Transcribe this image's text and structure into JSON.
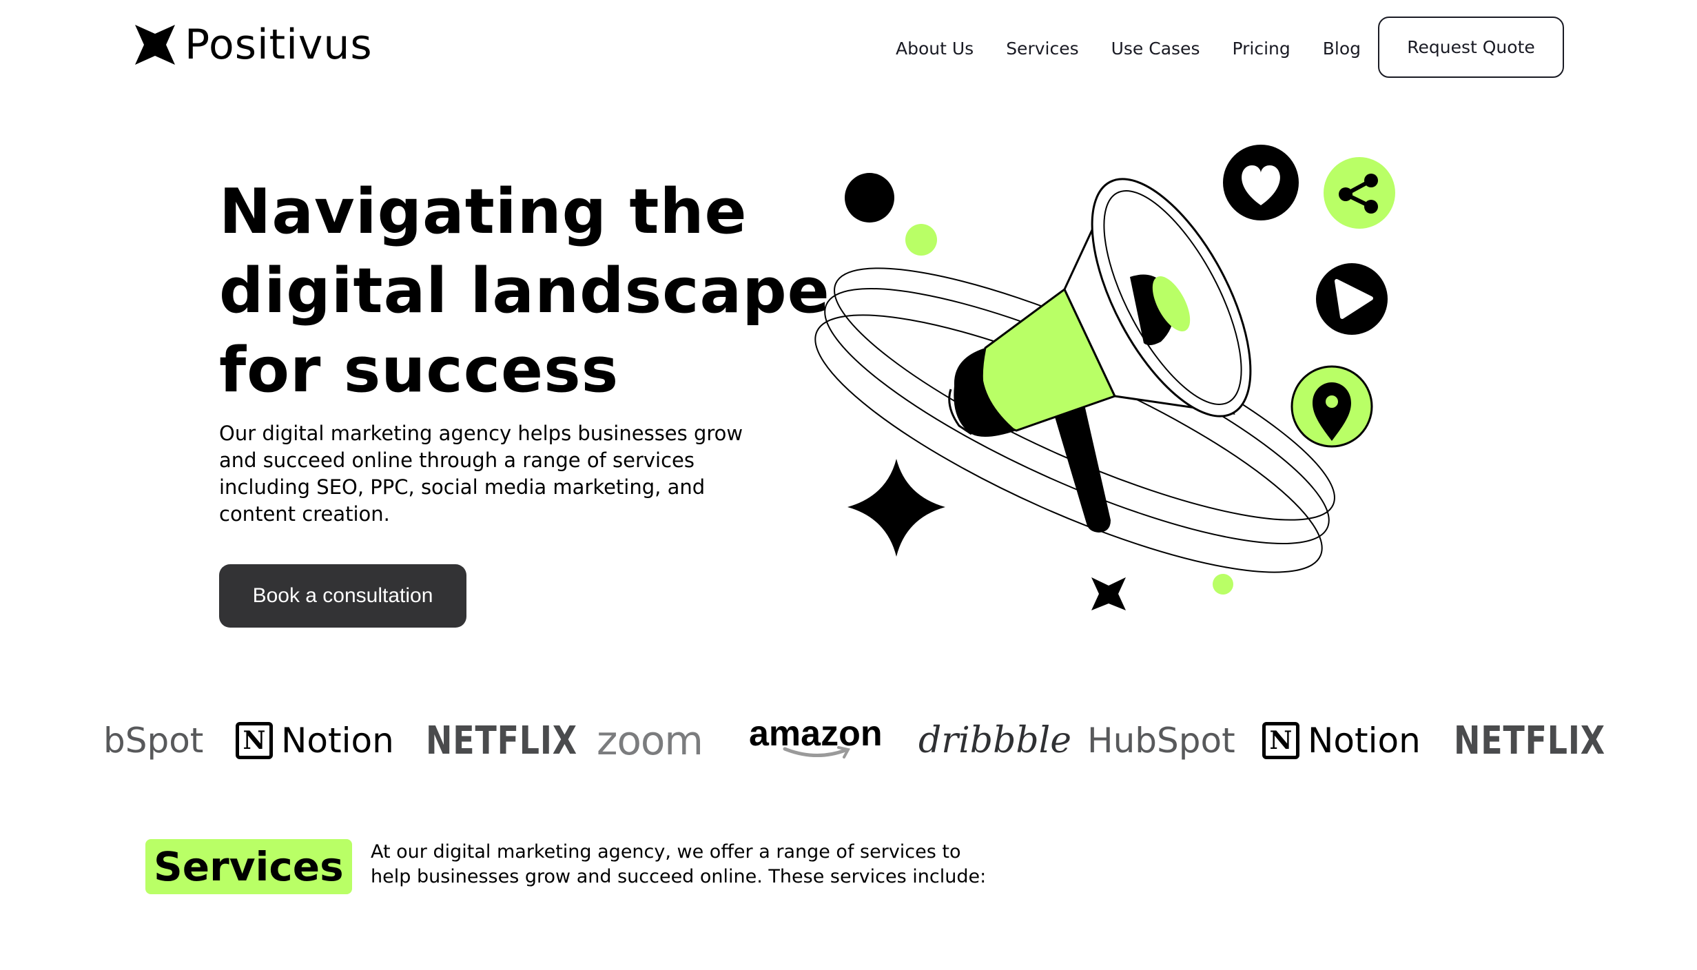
{
  "header": {
    "brand": "Positivus",
    "nav": [
      "About Us",
      "Services",
      "Use Cases",
      "Pricing",
      "Blog"
    ],
    "cta_label": "Request Quote"
  },
  "hero": {
    "title_lines": [
      "Navigating the",
      "digital landscape",
      "for success"
    ],
    "description": "Our digital marketing agency helps businesses grow and succeed online through a range of services including SEO, PPC, social media marketing, and content creation.",
    "cta_label": "Book a consultation",
    "illustration_icons": [
      "megaphone-icon",
      "heart-icon",
      "share-icon",
      "play-icon",
      "location-pin-icon",
      "sparkle-star-icon"
    ]
  },
  "logos": {
    "items": [
      "bSpot",
      "Notion",
      "NETFLIX",
      "zoom",
      "amazon",
      "dribbble",
      "HubSpot",
      "Notion",
      "NETFLIX"
    ],
    "notion_glyph": "N"
  },
  "services": {
    "heading": "Services",
    "description": "At our digital marketing agency, we offer a range of services to help businesses grow and succeed online. These services include:"
  },
  "colors": {
    "accent": "#b9ff66",
    "dark": "#191a23",
    "button_dark": "#333335",
    "background": "#ffffff"
  }
}
